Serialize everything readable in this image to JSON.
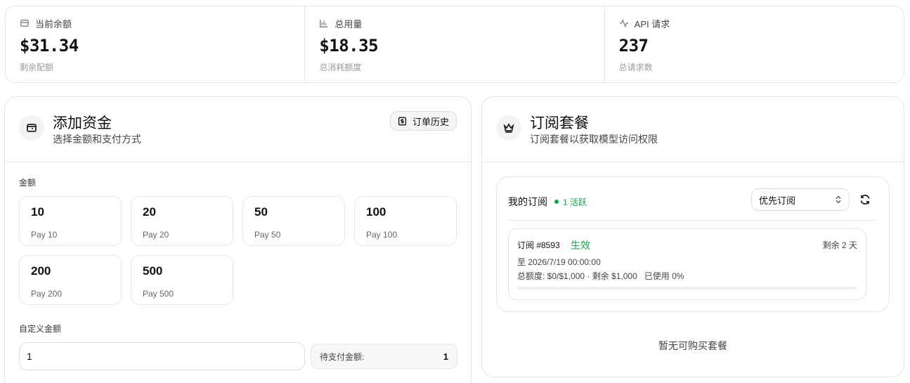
{
  "stats": [
    {
      "icon": "wallet-icon",
      "label": "当前余额",
      "value": "$31.34",
      "sub": "剩余配额"
    },
    {
      "icon": "bar-chart-icon",
      "label": "总用量",
      "value": "$18.35",
      "sub": "总消耗额度"
    },
    {
      "icon": "activity-icon",
      "label": "API 请求",
      "value": "237",
      "sub": "总请求数"
    }
  ],
  "add_funds": {
    "title": "添加资金",
    "subtitle": "选择金额和支付方式",
    "history_label": "订单历史",
    "amount_label": "金额",
    "amounts": [
      {
        "value": "10",
        "pay": "Pay 10"
      },
      {
        "value": "20",
        "pay": "Pay 20"
      },
      {
        "value": "50",
        "pay": "Pay 50"
      },
      {
        "value": "100",
        "pay": "Pay 100"
      },
      {
        "value": "200",
        "pay": "Pay 200"
      },
      {
        "value": "500",
        "pay": "Pay 500"
      }
    ],
    "custom_label": "自定义金额",
    "custom_value": "1",
    "pending_label": "待支付金额:",
    "pending_value": "1"
  },
  "subscription": {
    "title": "订阅套餐",
    "subtitle": "订阅套餐以获取模型访问权限",
    "my_label": "我的订阅",
    "active_badge": "1 活跃",
    "select_value": "优先订阅",
    "item": {
      "id": "订阅 #8593",
      "status": "生效",
      "remaining": "剩余 2 天",
      "until": "至 2026/7/19 00:00:00",
      "quota": "总额度: $0/$1,000 · 剩余 $1,000   已使用 0%",
      "used_percent": 0
    },
    "empty_note": "暂无可购买套餐"
  },
  "colors": {
    "accent_green": "#16a34a",
    "border": "#e5e5e5"
  }
}
